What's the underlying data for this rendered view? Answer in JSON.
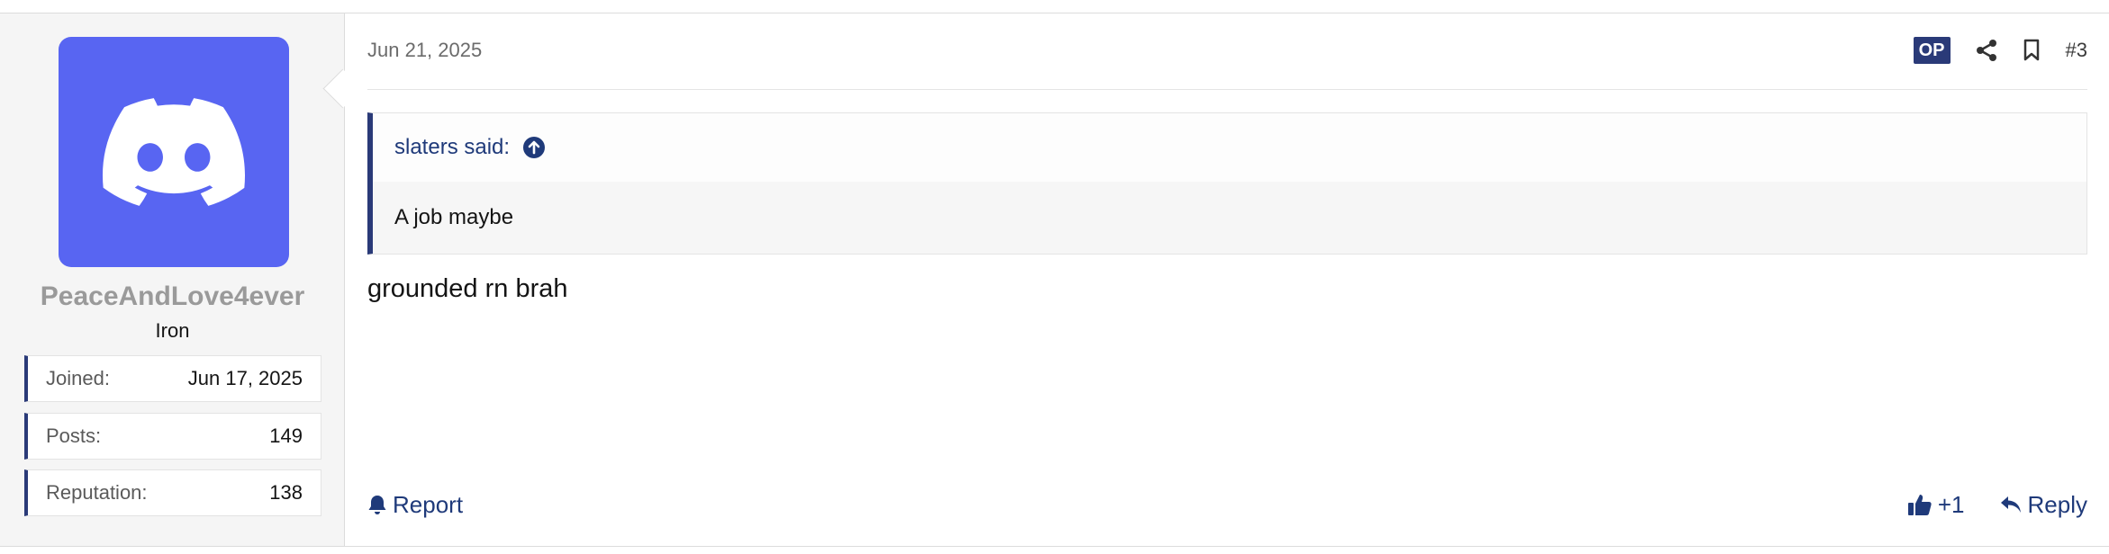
{
  "user": {
    "name": "PeaceAndLove4ever",
    "rank": "Iron",
    "avatar_icon": "discord-logo-icon",
    "stats": [
      {
        "label": "Joined:",
        "value": "Jun 17, 2025"
      },
      {
        "label": "Posts:",
        "value": "149"
      },
      {
        "label": "Reputation:",
        "value": "138"
      }
    ]
  },
  "post": {
    "date": "Jun 21, 2025",
    "op_badge": "OP",
    "number": "#3",
    "quote": {
      "author_line": "slaters said:",
      "text": "A job maybe"
    },
    "message": "grounded rn brah"
  },
  "footer": {
    "report_label": "Report",
    "like_label": "+1",
    "reply_label": "Reply"
  },
  "colors": {
    "accent": "#2a3a78",
    "link": "#1f3a7a",
    "discord": "#5865F2"
  }
}
